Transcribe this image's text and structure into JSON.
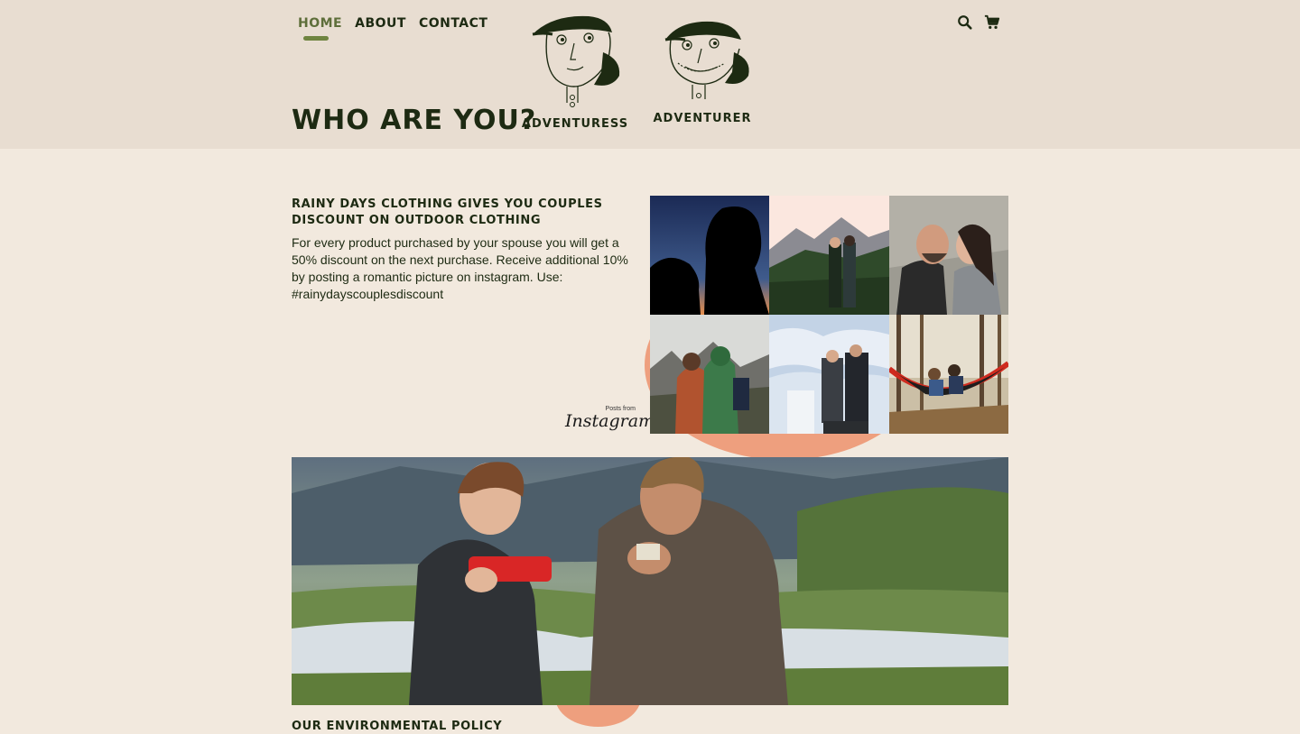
{
  "nav": {
    "items": [
      {
        "label": "HOME",
        "active": true
      },
      {
        "label": "ABOUT",
        "active": false
      },
      {
        "label": "CONTACT",
        "active": false
      }
    ]
  },
  "header_icons": [
    "search-icon",
    "cart-icon"
  ],
  "page_title": "WHO ARE YOU?",
  "personas": [
    {
      "label": "ADVENTURESS"
    },
    {
      "label": "ADVENTURER"
    }
  ],
  "promo": {
    "title": "RAINY DAYS CLOTHING GIVES YOU COUPLES DISCOUNT ON OUTDOOR CLOTHING",
    "text": "For every product purchased by your spouse you will get a 50% discount on the next purchase. Receive additional 10% by posting a romantic picture on instagram. Use: #rainydayscouplesdiscount"
  },
  "instagram": {
    "caption": "Posts from",
    "brand": "Instagram"
  },
  "environment": {
    "title": "OUR ENVIRONMENTAL POLICY"
  },
  "colors": {
    "header_bg": "#e8ddd1",
    "page_bg": "#f2e9de",
    "text": "#1d2a12",
    "accent_green": "#6f8440",
    "accent_coral": "#ee9f7e"
  }
}
